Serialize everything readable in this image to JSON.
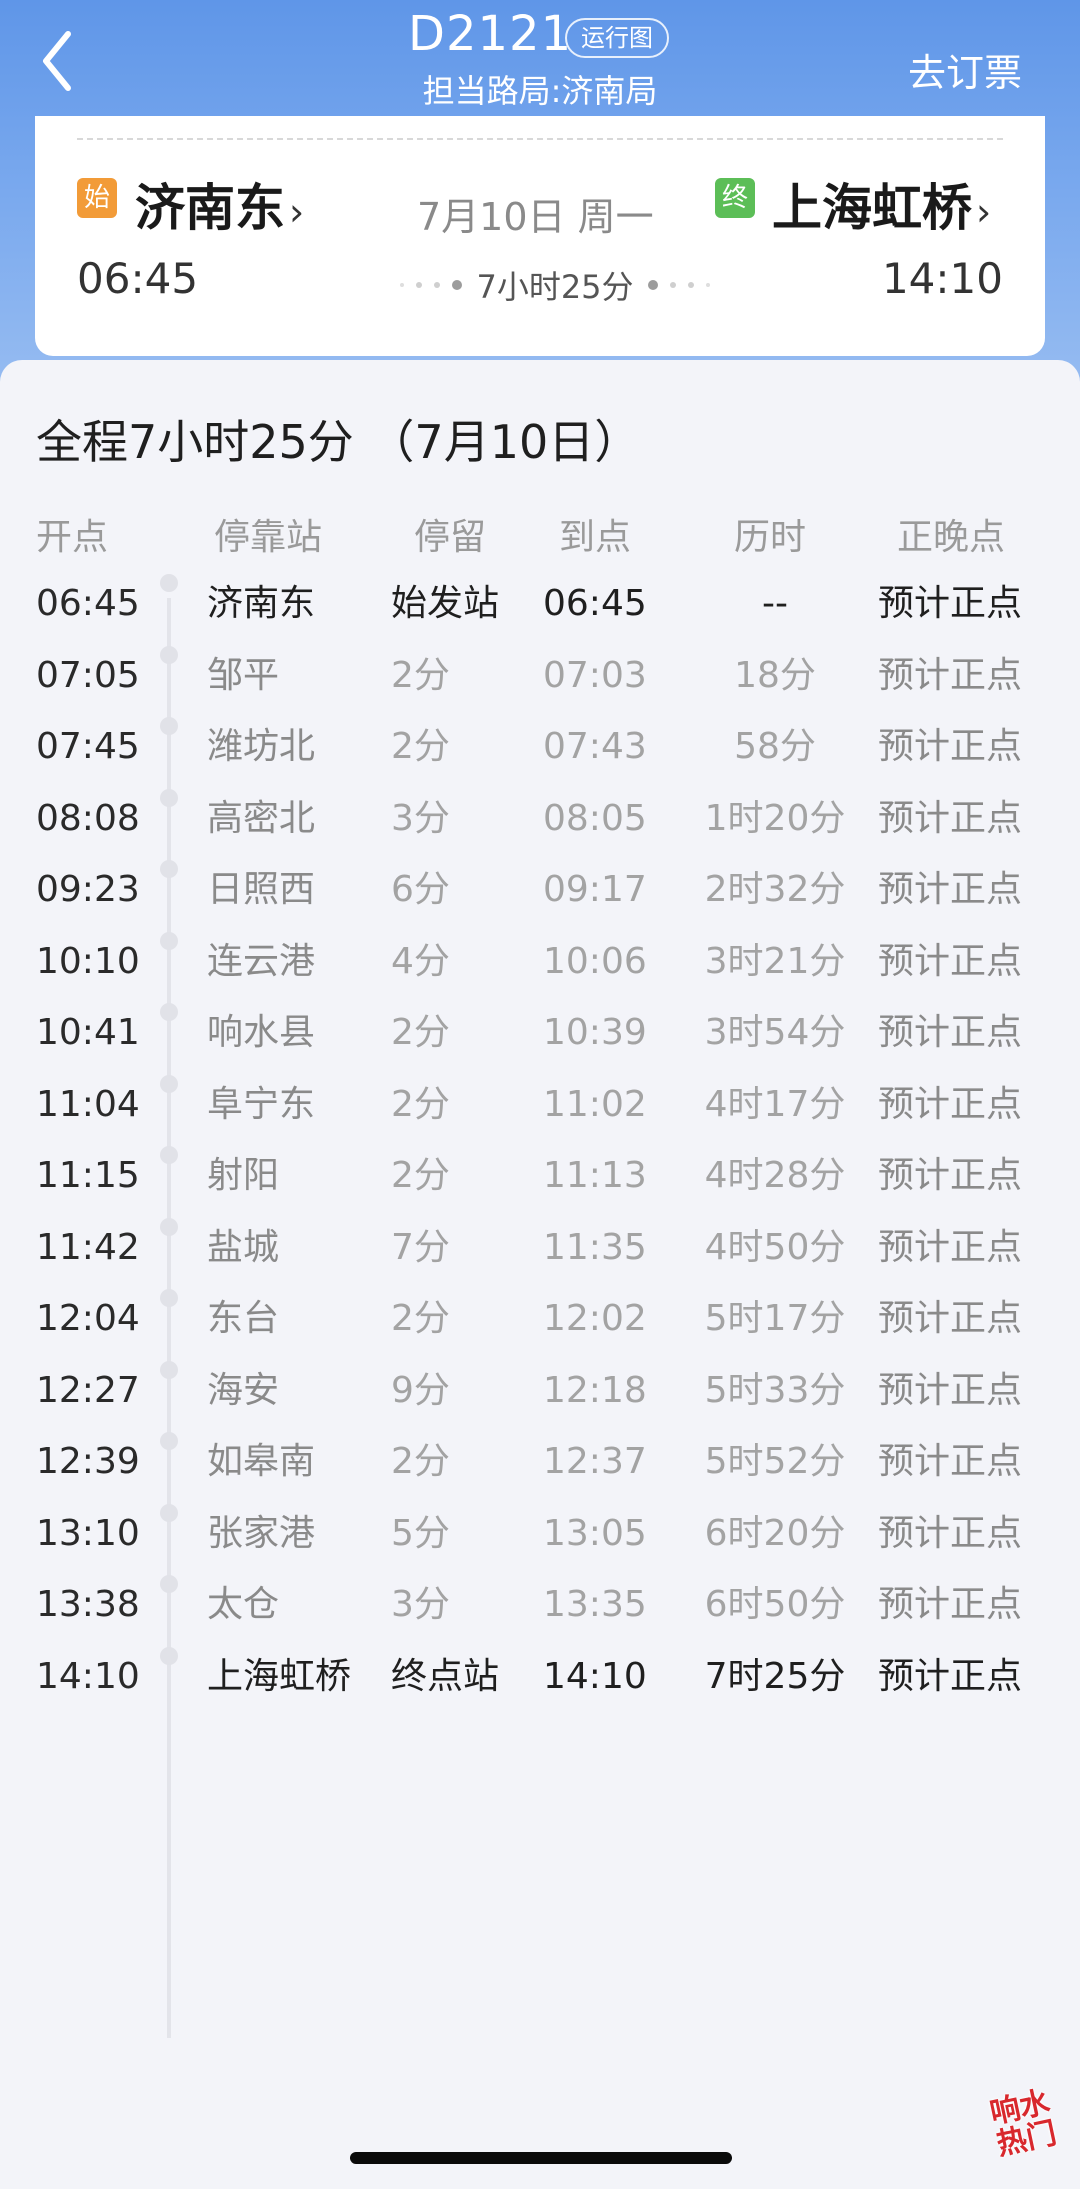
{
  "header": {
    "train_no": "D2121",
    "run_chart_label": "运行图",
    "bureau": "担当路局:济南局",
    "book_label": "去订票"
  },
  "trip": {
    "start_tag": "始",
    "end_tag": "终",
    "from_station": "济南东",
    "to_station": "上海虹桥",
    "date": "7月10日 周一",
    "dep_time": "06:45",
    "arr_time": "14:10",
    "duration": "7小时25分"
  },
  "schedule": {
    "summary": "全程7小时25分 （7月10日）",
    "columns": [
      "开点",
      "停靠站",
      "停留",
      "到点",
      "历时",
      "正晚点"
    ],
    "rows": [
      {
        "dep": "06:45",
        "station": "济南东",
        "stop": "始发站",
        "arr": "06:45",
        "elapsed": "--",
        "status": "预计正点"
      },
      {
        "dep": "07:05",
        "station": "邹平",
        "stop": "2分",
        "arr": "07:03",
        "elapsed": "18分",
        "status": "预计正点"
      },
      {
        "dep": "07:45",
        "station": "潍坊北",
        "stop": "2分",
        "arr": "07:43",
        "elapsed": "58分",
        "status": "预计正点"
      },
      {
        "dep": "08:08",
        "station": "高密北",
        "stop": "3分",
        "arr": "08:05",
        "elapsed": "1时20分",
        "status": "预计正点"
      },
      {
        "dep": "09:23",
        "station": "日照西",
        "stop": "6分",
        "arr": "09:17",
        "elapsed": "2时32分",
        "status": "预计正点"
      },
      {
        "dep": "10:10",
        "station": "连云港",
        "stop": "4分",
        "arr": "10:06",
        "elapsed": "3时21分",
        "status": "预计正点"
      },
      {
        "dep": "10:41",
        "station": "响水县",
        "stop": "2分",
        "arr": "10:39",
        "elapsed": "3时54分",
        "status": "预计正点"
      },
      {
        "dep": "11:04",
        "station": "阜宁东",
        "stop": "2分",
        "arr": "11:02",
        "elapsed": "4时17分",
        "status": "预计正点"
      },
      {
        "dep": "11:15",
        "station": "射阳",
        "stop": "2分",
        "arr": "11:13",
        "elapsed": "4时28分",
        "status": "预计正点"
      },
      {
        "dep": "11:42",
        "station": "盐城",
        "stop": "7分",
        "arr": "11:35",
        "elapsed": "4时50分",
        "status": "预计正点"
      },
      {
        "dep": "12:04",
        "station": "东台",
        "stop": "2分",
        "arr": "12:02",
        "elapsed": "5时17分",
        "status": "预计正点"
      },
      {
        "dep": "12:27",
        "station": "海安",
        "stop": "9分",
        "arr": "12:18",
        "elapsed": "5时33分",
        "status": "预计正点"
      },
      {
        "dep": "12:39",
        "station": "如皋南",
        "stop": "2分",
        "arr": "12:37",
        "elapsed": "5时52分",
        "status": "预计正点"
      },
      {
        "dep": "13:10",
        "station": "张家港",
        "stop": "5分",
        "arr": "13:05",
        "elapsed": "6时20分",
        "status": "预计正点"
      },
      {
        "dep": "13:38",
        "station": "太仓",
        "stop": "3分",
        "arr": "13:35",
        "elapsed": "6时50分",
        "status": "预计正点"
      },
      {
        "dep": "14:10",
        "station": "上海虹桥",
        "stop": "终点站",
        "arr": "14:10",
        "elapsed": "7时25分",
        "status": "预计正点"
      }
    ]
  },
  "watermark": {
    "line1": "响水",
    "line2": "热门"
  },
  "icons": {
    "back": "back-arrow-icon"
  },
  "colors": {
    "header_blue": "#5f96e8",
    "start_orange": "#f29b38",
    "end_green": "#5cbe57",
    "watermark_red": "#d8282d"
  }
}
